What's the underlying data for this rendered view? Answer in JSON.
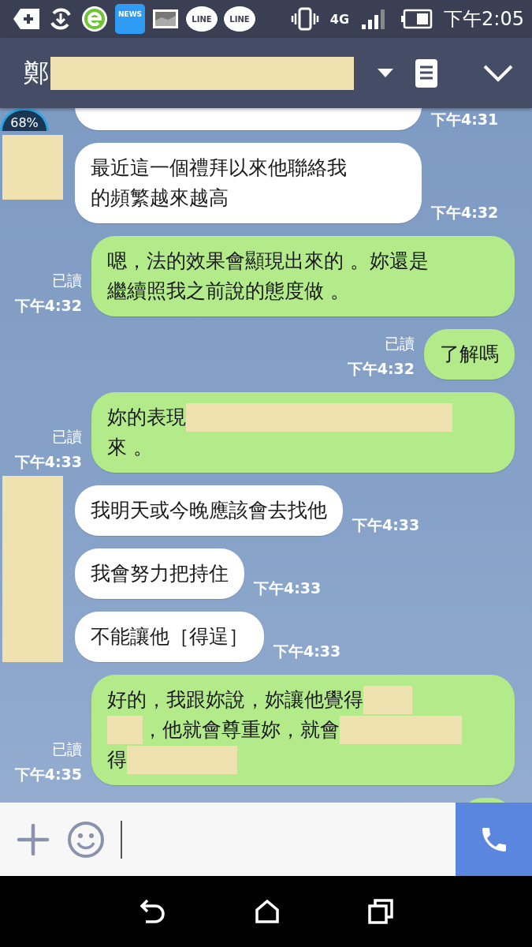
{
  "status_bar": {
    "news_label": "NEWS",
    "line_labels": [
      "LINE",
      "LINE"
    ],
    "network": "4G",
    "time": "下午2:05"
  },
  "header": {
    "title": "鄭",
    "title_redacted": true
  },
  "floating_widget": {
    "label": "68%"
  },
  "messages": [
    {
      "kind": "incoming",
      "avatar_redacted": false,
      "bubbles": [
        {
          "kind": "cut",
          "time": "下午4:31"
        }
      ]
    },
    {
      "kind": "incoming",
      "avatar_redacted": true,
      "bubbles": [
        {
          "kind": "text",
          "segments": [
            {
              "kind": "text",
              "text": "最近這一個禮拜以來他聯絡我"
            },
            {
              "kind": "break"
            },
            {
              "kind": "text",
              "text": "的頻繁越來越高"
            }
          ],
          "time": "下午4:32"
        }
      ]
    },
    {
      "kind": "outgoing",
      "read": "已讀",
      "time": "下午4:32",
      "segments": [
        {
          "kind": "text",
          "text": "嗯，法的效果會顯現出來的 。妳還是"
        },
        {
          "kind": "break"
        },
        {
          "kind": "text",
          "text": "繼續照我之前說的態度做 。"
        }
      ]
    },
    {
      "kind": "outgoing",
      "read": "已讀",
      "time": "下午4:32",
      "segments": [
        {
          "kind": "text",
          "text": "了解嗎"
        }
      ]
    },
    {
      "kind": "outgoing",
      "read": "已讀",
      "time": "下午4:33",
      "segments": [
        {
          "kind": "text",
          "text": "妳的表現"
        },
        {
          "kind": "redacted"
        },
        {
          "kind": "break"
        },
        {
          "kind": "text",
          "text": "來 。"
        }
      ]
    },
    {
      "kind": "incoming",
      "avatar_redacted": true,
      "bubbles": [
        {
          "kind": "text",
          "segments": [
            {
              "kind": "text",
              "text": "我明天或今晚應該會去找他"
            }
          ],
          "time": "下午4:33"
        },
        {
          "kind": "text",
          "segments": [
            {
              "kind": "text",
              "text": "我會努力把持住"
            }
          ],
          "time": "下午4:33"
        },
        {
          "kind": "text",
          "segments": [
            {
              "kind": "text",
              "text": "不能讓他［得逞］"
            }
          ],
          "time": "下午4:33"
        }
      ]
    },
    {
      "kind": "outgoing",
      "read": "已讀",
      "time": "下午4:35",
      "segments": [
        {
          "kind": "text",
          "text": "好的，我跟妳說，妳讓他覺得"
        },
        {
          "kind": "redacted"
        },
        {
          "kind": "break"
        },
        {
          "kind": "redacted"
        },
        {
          "kind": "text",
          "text": "，他就會尊重妳，就會"
        },
        {
          "kind": "redacted"
        },
        {
          "kind": "break"
        },
        {
          "kind": "text",
          "text": "得"
        },
        {
          "kind": "redacted"
        }
      ]
    },
    {
      "kind": "outgoing_cut"
    }
  ]
}
